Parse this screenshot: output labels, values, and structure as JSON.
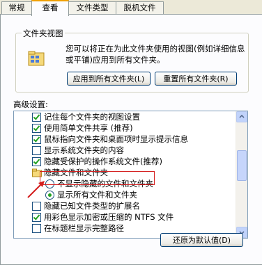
{
  "tabs": [
    "常规",
    "查看",
    "文件类型",
    "脱机文件"
  ],
  "active_tab": 1,
  "folder_views": {
    "title": "文件夹视图",
    "description": "您可以将正在为此文件夹使用的视图(例如详细信息或平铺)应用到所有文件夹。",
    "apply_all_label": "应用到所有文件夹(L)",
    "reset_all_label": "重置所有文件夹(R)"
  },
  "advanced": {
    "label": "高级设置:",
    "items": [
      {
        "type": "checkbox",
        "checked": true,
        "label": "记住每个文件夹的视图设置"
      },
      {
        "type": "checkbox",
        "checked": true,
        "label": "使用简单文件共享 (推荐)"
      },
      {
        "type": "checkbox",
        "checked": true,
        "label": "鼠标指向文件夹和桌面项时显示提示信息"
      },
      {
        "type": "checkbox",
        "checked": false,
        "label": "显示系统文件夹的内容"
      },
      {
        "type": "checkbox",
        "checked": true,
        "label": "隐藏受保护的操作系统文件(推荐)"
      },
      {
        "type": "folder",
        "label": "隐藏文件和文件夹"
      },
      {
        "type": "radio",
        "checked": false,
        "label": "不显示隐藏的文件和文件夹"
      },
      {
        "type": "radio",
        "checked": true,
        "label": "显示所有文件和文件夹"
      },
      {
        "type": "checkbox",
        "checked": false,
        "label": "隐藏已知文件类型的扩展名"
      },
      {
        "type": "checkbox",
        "checked": true,
        "label": "用彩色显示加密或压缩的 NTFS 文件"
      },
      {
        "type": "checkbox",
        "checked": false,
        "label": "在标题栏显示完整路径"
      }
    ]
  },
  "restore_defaults_label": "还原为默认值(D)",
  "colors": {
    "highlight_box": "#d42020",
    "check": "#21a121",
    "tab_accent": "#f0a000"
  }
}
